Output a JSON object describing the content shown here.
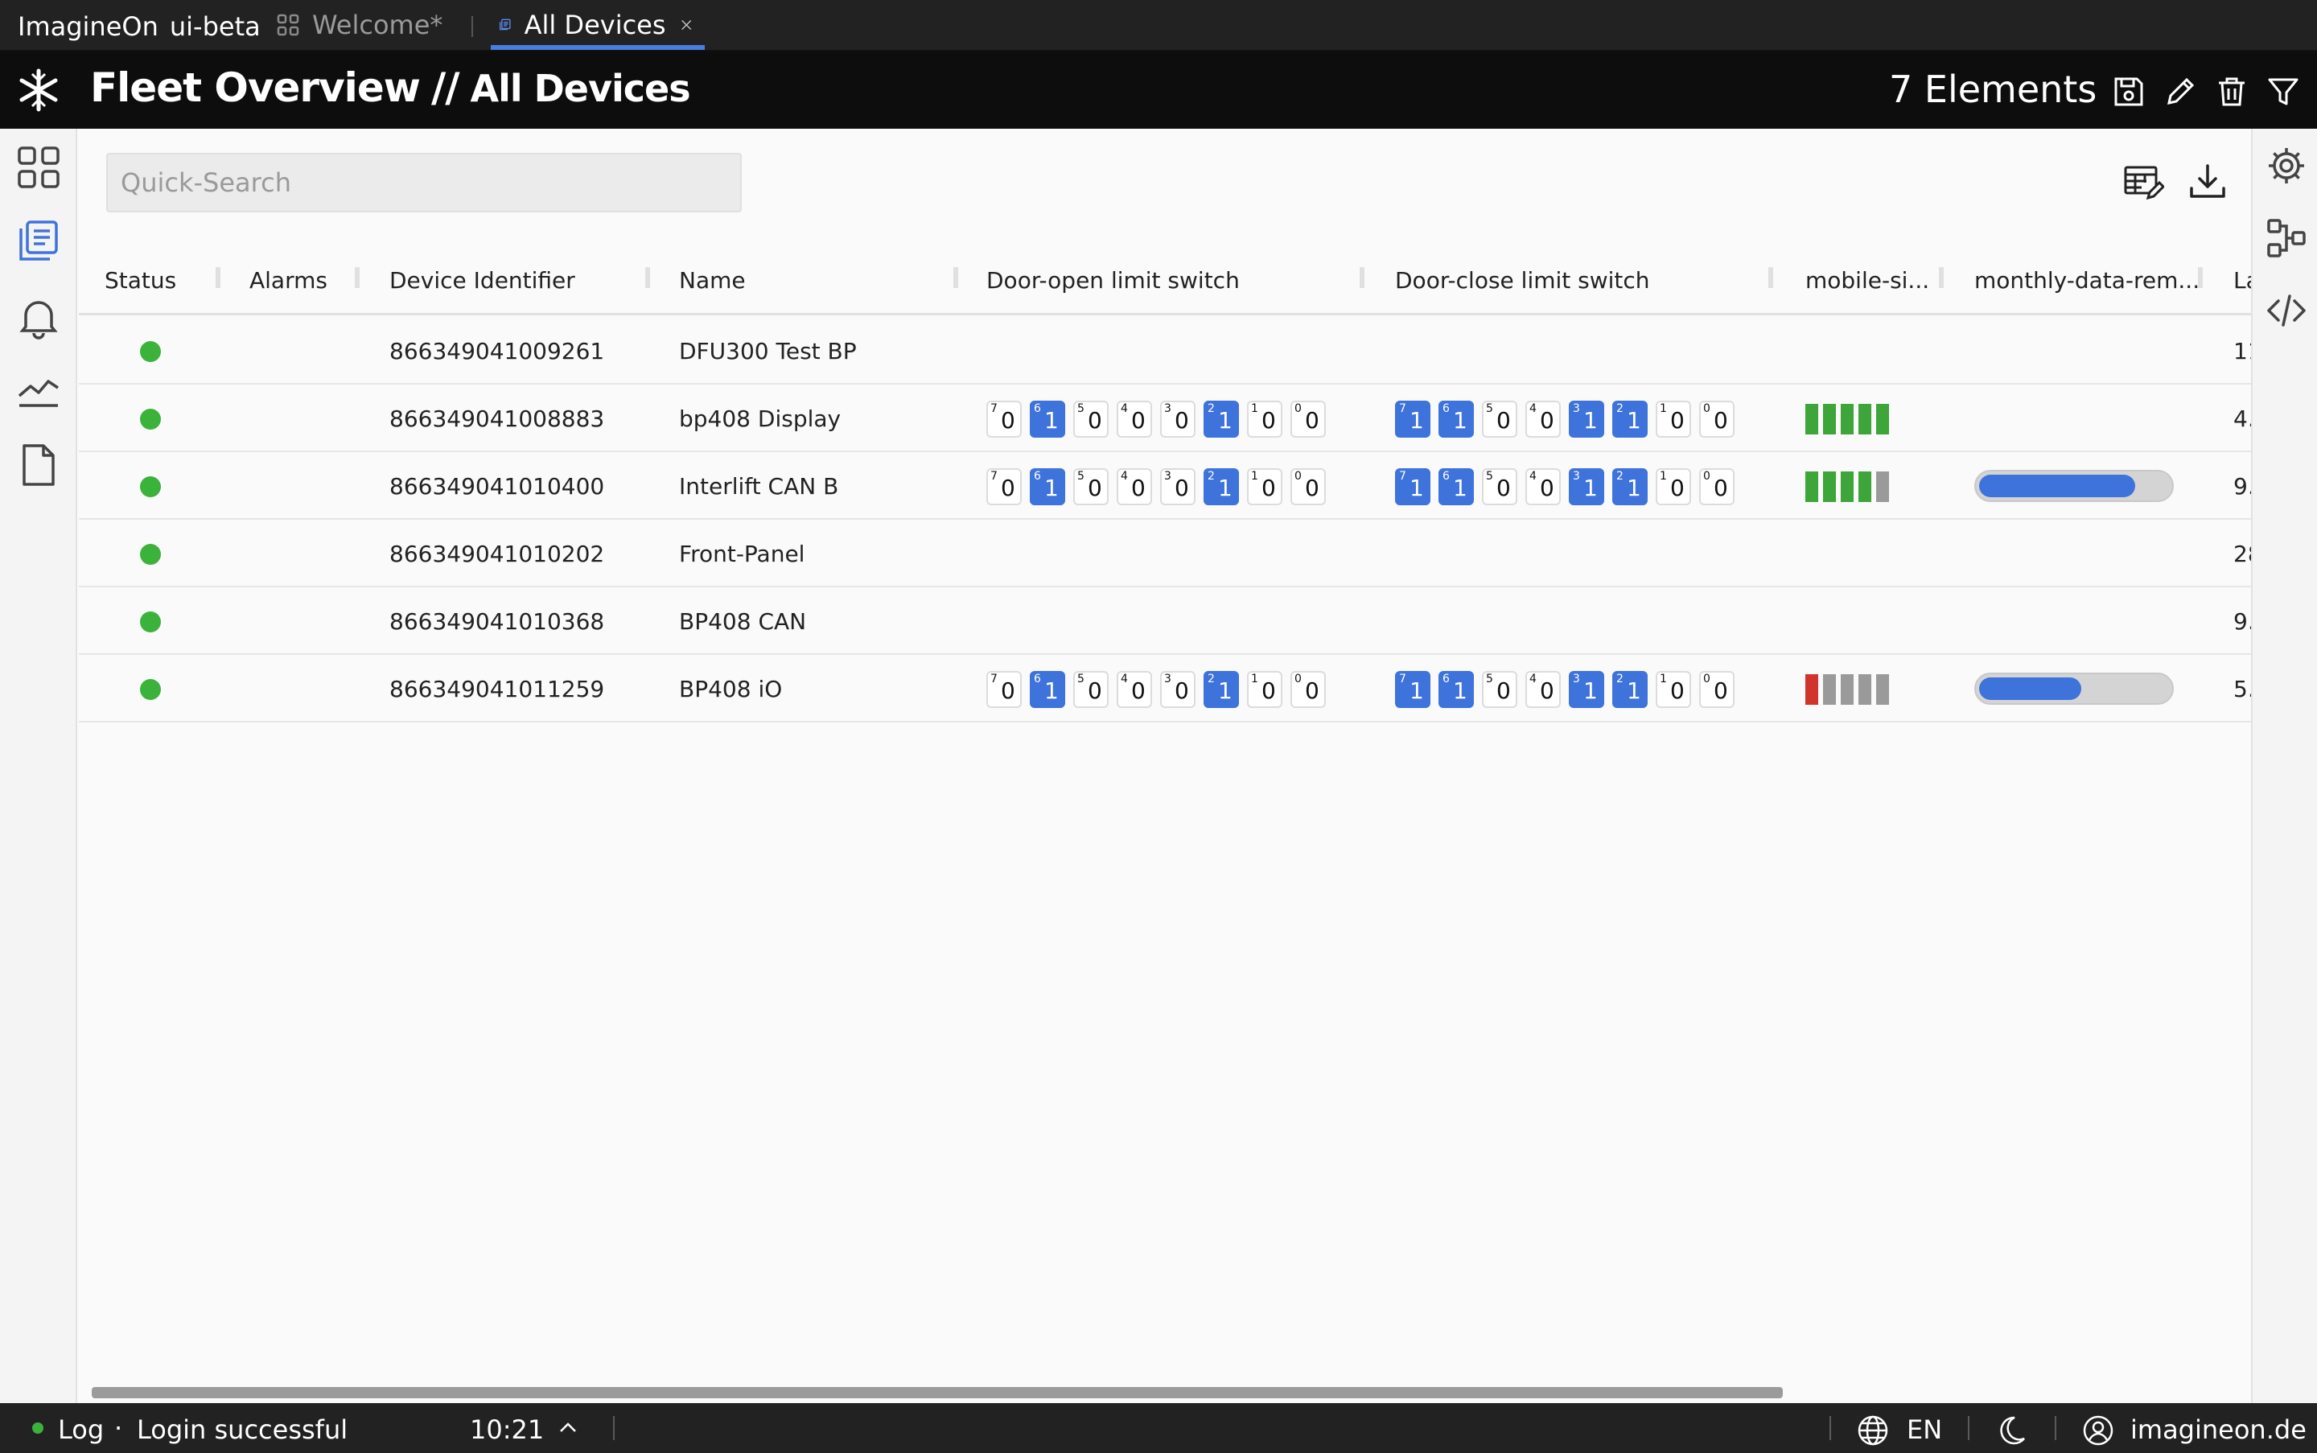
{
  "app": {
    "name": "ImagineOn",
    "channel": "ui-beta"
  },
  "tabs": [
    {
      "label": "Welcome*",
      "active": false
    },
    {
      "label": "All Devices",
      "active": true
    }
  ],
  "header": {
    "title": "Fleet Overview",
    "separator": "//",
    "subtitle": "All Devices",
    "element_count": "7 Elements"
  },
  "search": {
    "placeholder": "Quick-Search",
    "value": ""
  },
  "columns": [
    "Status",
    "Alarms",
    "Device Identifier",
    "Name",
    "Door-open limit switch",
    "Door-close limit switch",
    "mobile-si...",
    "monthly-data-rem...",
    "La"
  ],
  "bit_indices": [
    "7",
    "6",
    "5",
    "4",
    "3",
    "2",
    "1",
    "0"
  ],
  "rows": [
    {
      "status": "online",
      "status_color": "#3bb33b",
      "identifier": "866349041009261",
      "name": "DFU300 Test BP",
      "door_open": null,
      "door_close": null,
      "signal": null,
      "data_remaining": null,
      "last": "11."
    },
    {
      "status": "online",
      "status_color": "#3bb33b",
      "identifier": "866349041008883",
      "name": "bp408 Display",
      "door_open": [
        "0",
        "1",
        "0",
        "0",
        "0",
        "1",
        "0",
        "0"
      ],
      "door_close": [
        "1",
        "1",
        "0",
        "0",
        "1",
        "1",
        "0",
        "0"
      ],
      "signal": {
        "bars": 5,
        "color": "#3da53a"
      },
      "data_remaining": null,
      "last": "4."
    },
    {
      "status": "online",
      "status_color": "#3bb33b",
      "identifier": "866349041010400",
      "name": "Interlift CAN B",
      "door_open": [
        "0",
        "1",
        "0",
        "0",
        "0",
        "1",
        "0",
        "0"
      ],
      "door_close": [
        "1",
        "1",
        "0",
        "0",
        "1",
        "1",
        "0",
        "0"
      ],
      "signal": {
        "bars": 4,
        "color": "#3da53a"
      },
      "data_remaining": 0.82,
      "last": "9."
    },
    {
      "status": "online",
      "status_color": "#3bb33b",
      "identifier": "866349041010202",
      "name": "Front-Panel",
      "door_open": null,
      "door_close": null,
      "signal": null,
      "data_remaining": null,
      "last": "28"
    },
    {
      "status": "online",
      "status_color": "#3bb33b",
      "identifier": "866349041010368",
      "name": "BP408 CAN",
      "door_open": null,
      "door_close": null,
      "signal": null,
      "data_remaining": null,
      "last": "9."
    },
    {
      "status": "online",
      "status_color": "#3bb33b",
      "identifier": "866349041011259",
      "name": "BP408 iO",
      "door_open": [
        "0",
        "1",
        "0",
        "0",
        "0",
        "1",
        "0",
        "0"
      ],
      "door_close": [
        "1",
        "1",
        "0",
        "0",
        "1",
        "1",
        "0",
        "0"
      ],
      "signal": {
        "bars": 1,
        "color": "#d0342c"
      },
      "data_remaining": 0.54,
      "last": "5."
    }
  ],
  "colors": {
    "accent": "#3e73dc",
    "online": "#3bb33b",
    "signal_ok": "#3da53a",
    "signal_low": "#d0342c",
    "signal_empty": "#9a9a9a"
  },
  "statusbar": {
    "log_label": "Log",
    "message": "Login successful",
    "time": "10:21",
    "language": "EN",
    "user": "imagineon.de"
  },
  "icons": {
    "tabbar": [
      "grid-icon",
      "document-list-icon",
      "close-icon"
    ],
    "header": [
      "save-icon",
      "edit-icon",
      "delete-icon",
      "filter-icon"
    ],
    "left_rail": [
      "dashboard-icon",
      "devices-icon",
      "alarms-icon",
      "charts-icon",
      "document-icon"
    ],
    "right_rail": [
      "settings-icon",
      "workflow-icon",
      "code-icon"
    ],
    "toolbar": [
      "table-edit-icon",
      "download-icon"
    ]
  }
}
